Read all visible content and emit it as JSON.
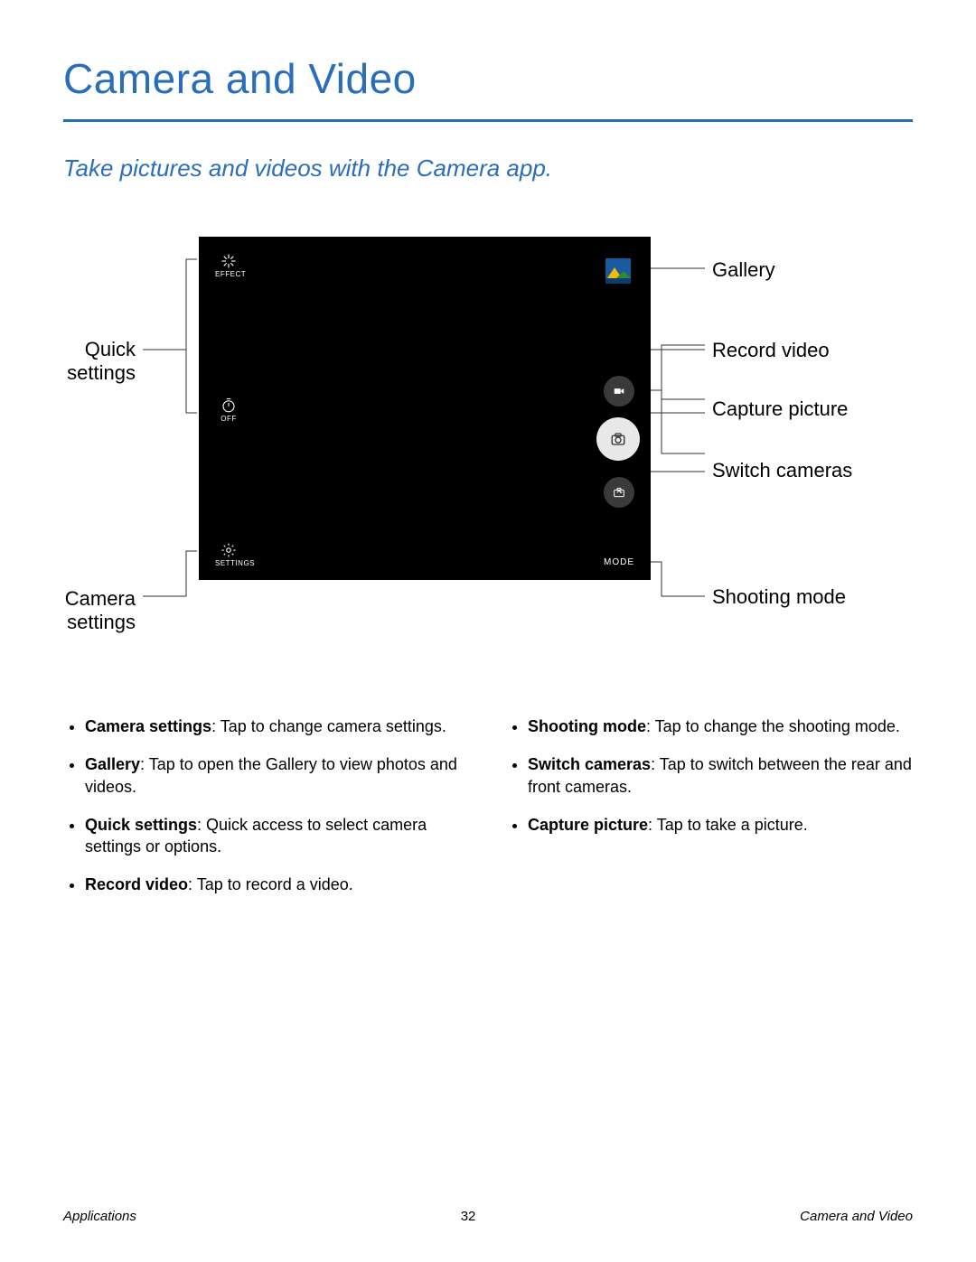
{
  "title": "Camera and Video",
  "subtitle": "Take pictures and videos with the Camera app.",
  "callouts": {
    "quick_settings": "Quick settings",
    "camera_settings": "Camera settings",
    "gallery": "Gallery",
    "record_video": "Record video",
    "capture_picture": "Capture picture",
    "switch_cameras": "Switch cameras",
    "shooting_mode": "Shooting mode"
  },
  "screen_labels": {
    "effect": "EFFECT",
    "timer": "OFF",
    "settings": "SETTINGS",
    "mode": "MODE"
  },
  "bullets": {
    "left": [
      {
        "term": "Camera settings",
        "text": ": Tap to change camera settings."
      },
      {
        "term": "Gallery",
        "text": ": Tap to open the Gallery to view photos and videos."
      },
      {
        "term": "Quick settings",
        "text": ": Quick access to select camera settings or options."
      },
      {
        "term": "Record video",
        "text": ": Tap to record a video."
      }
    ],
    "right": [
      {
        "term": "Shooting mode",
        "text": ": Tap to change the shooting mode."
      },
      {
        "term": "Switch cameras",
        "text": ": Tap to switch between the rear and front cameras."
      },
      {
        "term": "Capture picture",
        "text": ": Tap to take a picture."
      }
    ]
  },
  "footer": {
    "left": "Applications",
    "center": "32",
    "right": "Camera and Video"
  }
}
